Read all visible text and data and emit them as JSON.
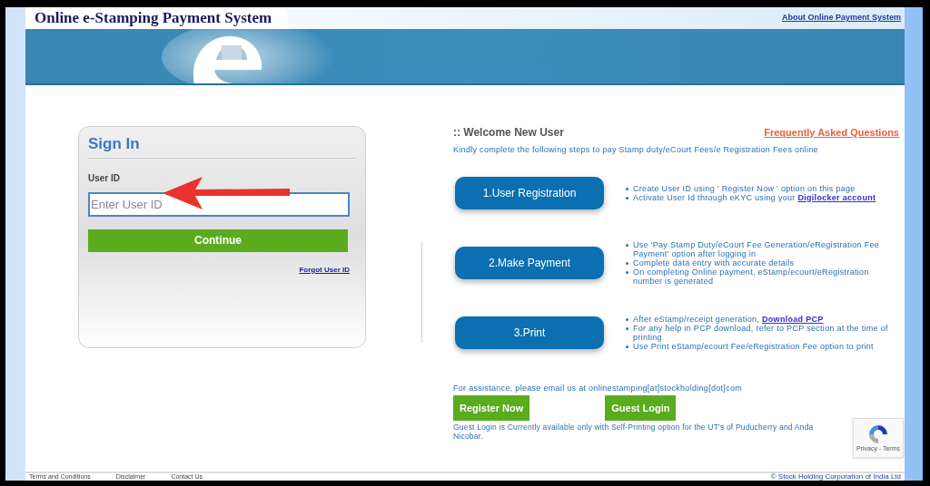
{
  "header": {
    "title": "Online e-Stamping Payment System",
    "link": "About Online Payment System"
  },
  "sign_in": {
    "title": "Sign In",
    "field_label": "User ID",
    "placeholder": "Enter User ID",
    "button": "Continue",
    "link": "Forgot User ID"
  },
  "welcome": {
    "title": ":: Welcome New User",
    "faq": "Frequently Asked Questions",
    "subtitle": "Kindly complete the following steps to pay Stamp duty/eCourt Fees/e Registration Fees online",
    "steps": [
      {
        "label": "1.User Registration",
        "bullets": [
          {
            "text": "Create User ID using ' Register Now ' option on this page"
          },
          {
            "text": "Activate User Id through eKYC using your ",
            "link": "Digilocker account"
          }
        ]
      },
      {
        "label": "2.Make Payment",
        "bullets": [
          {
            "text": "Use 'Pay Stamp Duty/eCourt Fee Generation/eRegistration Fee Payment' option after logging in"
          },
          {
            "text": "Complete data entry with accurate details"
          },
          {
            "text": "On completing Online payment, eStamp/ecourt/eRegistration number is generated"
          }
        ]
      },
      {
        "label": "3.Print",
        "bullets": [
          {
            "text": "After eStamp/receipt generation, ",
            "link": "Download PCP"
          },
          {
            "text": "For any help in PCP download, refer to PCP section at the time of printing"
          },
          {
            "text": "Use Print eStamp/ecourt Fee/eRegistration Fee option to print"
          }
        ]
      }
    ]
  },
  "assistance": "For assistance, please email us at onlinestamping[at]stockholding[dot]com",
  "actions": [
    "Register Now",
    "Guest Login"
  ],
  "notice": [
    "Guest Login is Currently available only with Self-Printing option for the UT's of Puducherry and Anda",
    "Nicobar."
  ],
  "recaptcha": {
    "links": "Privacy - Terms"
  },
  "footer": {
    "links": [
      "Terms and Conditions",
      "Disclaimer",
      "Contact Us"
    ],
    "copyright": "© Stock Holding Corporation of India Ltd"
  }
}
